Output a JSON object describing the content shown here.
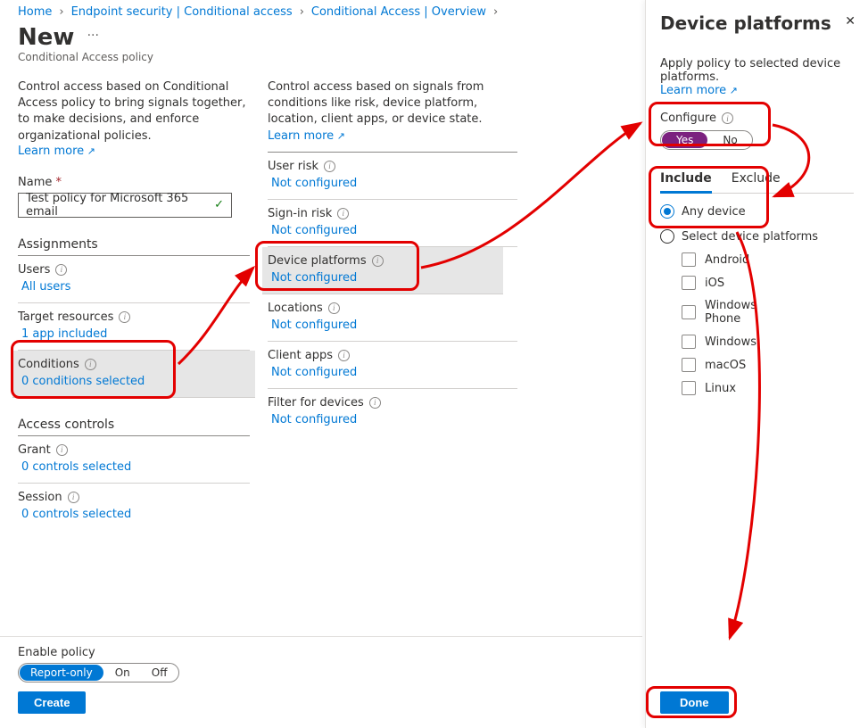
{
  "breadcrumbs": {
    "items": [
      "Home",
      "Endpoint security | Conditional access",
      "Conditional Access | Overview"
    ]
  },
  "header": {
    "title": "New",
    "subtitle": "Conditional Access policy"
  },
  "col1": {
    "desc": "Control access based on Conditional Access policy to bring signals together, to make decisions, and enforce organizational policies.",
    "learn_more": "Learn more",
    "name_label": "Name",
    "name_value": "Test policy for Microsoft 365 email",
    "assignments_header": "Assignments",
    "users": {
      "label": "Users",
      "value": "All users"
    },
    "target": {
      "label": "Target resources",
      "value": "1 app included"
    },
    "conditions": {
      "label": "Conditions",
      "value": "0 conditions selected"
    },
    "access_header": "Access controls",
    "grant": {
      "label": "Grant",
      "value": "0 controls selected"
    },
    "session": {
      "label": "Session",
      "value": "0 controls selected"
    }
  },
  "col2": {
    "desc_pre": "Control access based on signals from conditions like risk, device platform, location, client apps, or device state.",
    "learn_more": "Learn more",
    "user_risk": {
      "label": "User risk",
      "value": "Not configured"
    },
    "signin_risk": {
      "label": "Sign-in risk",
      "value": "Not configured"
    },
    "device_platforms": {
      "label": "Device platforms",
      "value": "Not configured"
    },
    "locations": {
      "label": "Locations",
      "value": "Not configured"
    },
    "client_apps": {
      "label": "Client apps",
      "value": "Not configured"
    },
    "filter": {
      "label": "Filter for devices",
      "value": "Not configured"
    }
  },
  "bottom": {
    "enable_label": "Enable policy",
    "opts": [
      "Report-only",
      "On",
      "Off"
    ],
    "create": "Create"
  },
  "panel": {
    "title": "Device platforms",
    "desc": "Apply policy to selected device platforms.",
    "learn_more": "Learn more",
    "configure_label": "Configure",
    "yes": "Yes",
    "no": "No",
    "tab_include": "Include",
    "tab_exclude": "Exclude",
    "radio_any": "Any device",
    "radio_select": "Select device platforms",
    "platforms": [
      "Android",
      "iOS",
      "Windows Phone",
      "Windows",
      "macOS",
      "Linux"
    ],
    "done": "Done"
  }
}
